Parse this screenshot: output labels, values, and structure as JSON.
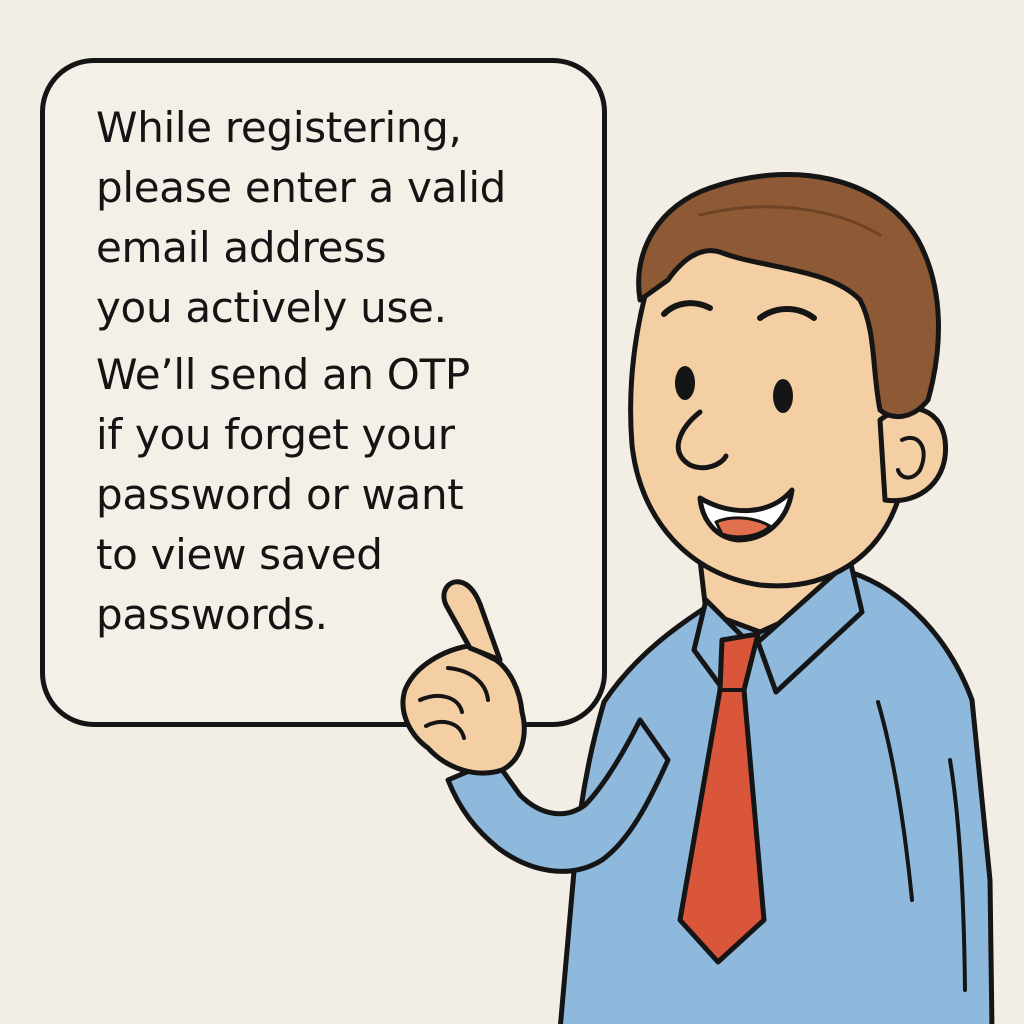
{
  "speech_bubble": {
    "paragraphs": [
      [
        "While registering,",
        "please enter a valid",
        "email address",
        "you actively use."
      ],
      [
        "We’ll send an OTP",
        "if you forget your",
        "password or want",
        "to view saved",
        "passwords."
      ]
    ]
  },
  "colors": {
    "background": "#f3eee5",
    "outline": "#151515",
    "skin": "#f4cfa3",
    "hair": "#8e5a35",
    "shirt": "#8fb9dc",
    "tie": "#d9563a",
    "tongue": "#e07050"
  },
  "illustration": {
    "subject": "man-in-shirt-and-tie-pointing-up",
    "icons": [
      "pointing-hand-icon"
    ]
  }
}
